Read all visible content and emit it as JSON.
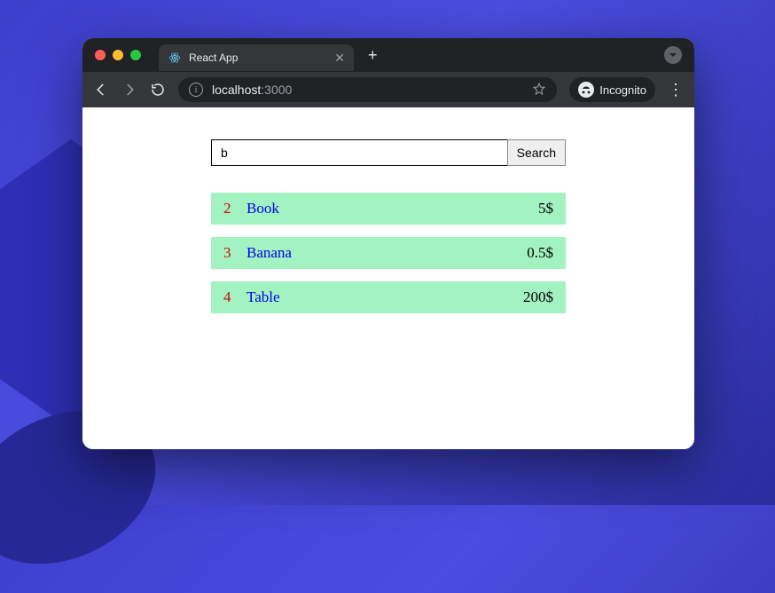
{
  "tab": {
    "title": "React App"
  },
  "address": {
    "host": "localhost",
    "port": ":3000"
  },
  "incognito": {
    "label": "Incognito"
  },
  "search": {
    "value": "b",
    "button_label": "Search"
  },
  "results": [
    {
      "id": "2",
      "name": "Book",
      "price": "5$"
    },
    {
      "id": "3",
      "name": "Banana",
      "price": "0.5$"
    },
    {
      "id": "4",
      "name": "Table",
      "price": "200$"
    }
  ]
}
